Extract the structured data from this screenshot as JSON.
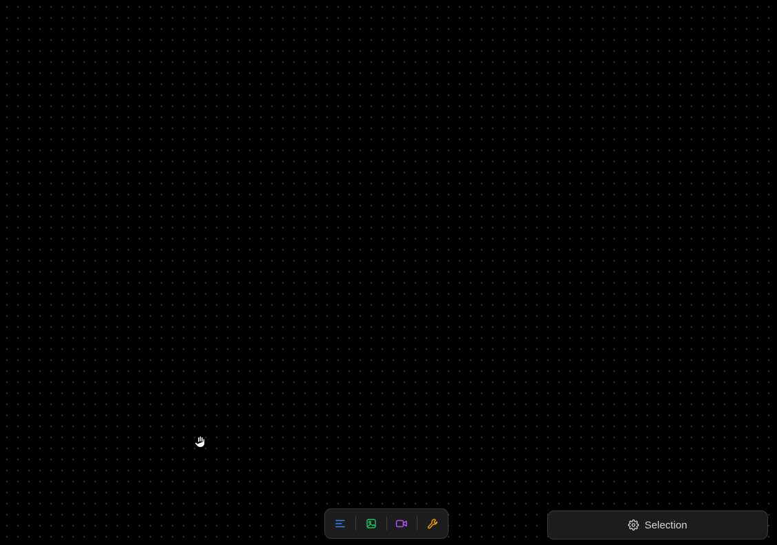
{
  "canvas": {
    "background": "#000000",
    "dot_color": "#3a3a3a"
  },
  "cursor": {
    "icon": "hand-icon"
  },
  "toolbar": {
    "tools": [
      {
        "name": "text-tool",
        "icon": "text-lines-icon",
        "color": "#3b82f6"
      },
      {
        "name": "image-tool",
        "icon": "image-icon",
        "color": "#22c55e"
      },
      {
        "name": "video-tool",
        "icon": "video-camera-icon",
        "color": "#a855f7"
      },
      {
        "name": "wrench-tool",
        "icon": "wrench-icon",
        "color": "#f59e0b"
      }
    ]
  },
  "selection_button": {
    "label": "Selection",
    "icon": "gear-icon"
  }
}
